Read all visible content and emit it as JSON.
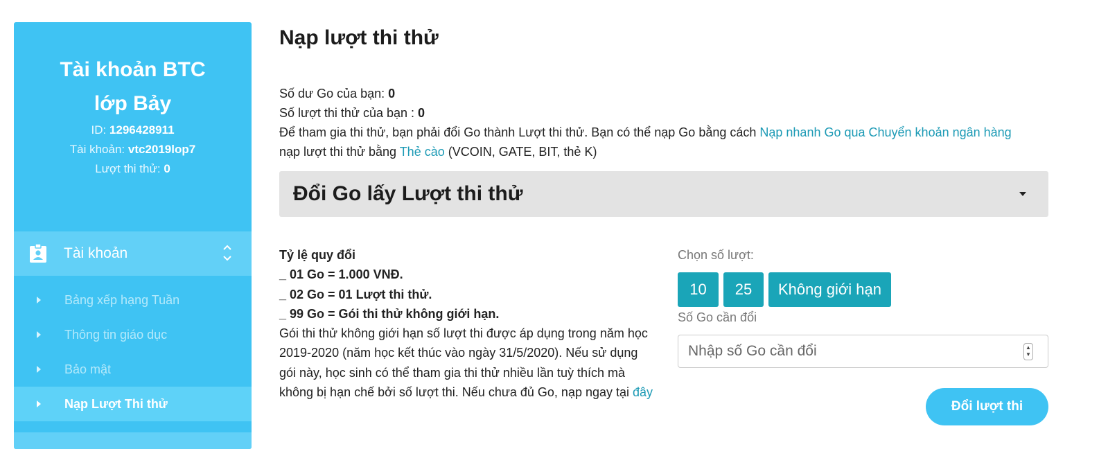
{
  "sidebar": {
    "profile": {
      "name_line1": "Tài khoản BTC",
      "name_line2": "lớp Bảy",
      "id_label": "ID: ",
      "id_value": "1296428911",
      "account_label": "Tài khoản: ",
      "account_value": "vtc2019lop7",
      "turns_label": "Lượt thi thử: ",
      "turns_value": "0"
    },
    "menu_head": {
      "label": "Tài khoản",
      "icon": "id-badge-icon",
      "toggle_icon": "chevron-updown-icon"
    },
    "items": [
      {
        "label": "Bảng xếp hạng Tuần",
        "active": false
      },
      {
        "label": "Thông tin giáo dục",
        "active": false
      },
      {
        "label": "Bảo mật",
        "active": false
      },
      {
        "label": "Nạp Lượt Thi thử",
        "active": true
      }
    ]
  },
  "main": {
    "title": "Nạp lượt thi thử",
    "balance_label": "Số dư Go của bạn: ",
    "balance_value": "0",
    "turns_label": "Số lượt thi thử của bạn : ",
    "turns_value": "0",
    "info_text1": "Để tham gia thi thử, bạn phải đổi Go thành Lượt thi thử. Bạn có thể nạp Go bằng cách ",
    "info_link1": "Nạp nhanh Go qua Chuyển khoản ngân hàng",
    "info_text2": "nạp lượt thi thử bằng ",
    "info_link2": "Thẻ cào",
    "info_text3": " (VCOIN, GATE, BIT, thẻ K)",
    "accordion_title": "Đổi Go lấy Lượt thi thử",
    "rates": {
      "heading": "Tỷ lệ quy đổi",
      "line1": "_ 01 Go = 1.000 VNĐ.",
      "line2": "_ 02 Go = 01 Lượt thi thử.",
      "line3": "_ 99 Go = Gói thi thử không giới hạn.",
      "description": "Gói thi thử không giới hạn số lượt thi được áp dụng trong năm học 2019-2020 (năm học kết thúc vào ngày 31/5/2020). Nếu sử dụng gói này, học sinh có thể tham gia thi thử nhiều lần tuỳ thích mà không bị hạn chế bởi số lượt thi. Nếu chưa đủ Go, nạp ngay tại ",
      "link": "đây"
    },
    "choose_label": "Chọn số lượt:",
    "options": [
      "10",
      "25",
      "Không giới hạn"
    ],
    "go_label": "Số Go cần đổi",
    "go_placeholder": "Nhập số Go cần đổi",
    "submit_label": "Đổi lượt thi"
  },
  "colors": {
    "sidebar": "#3fc3f3",
    "accent": "#1aa5b8",
    "link": "#1c9ab5"
  }
}
